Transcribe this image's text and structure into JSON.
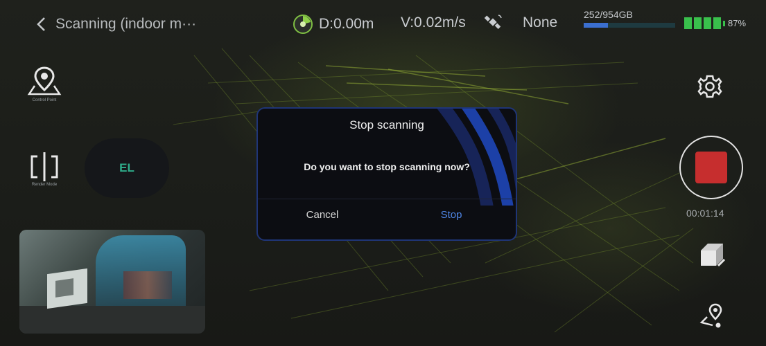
{
  "header": {
    "title": "Scanning (indoor m···",
    "distance": "D:0.00m",
    "velocity": "V:0.02m/s",
    "gnss_status": "None",
    "storage_text": "252/954GB",
    "storage_fraction": 0.264,
    "battery_percent": "87%",
    "battery_segments": 4
  },
  "left_panel": {
    "control_point_label": "Control Point",
    "render_mode_label": "Render Mode",
    "el_button_label": "EL"
  },
  "right_panel": {
    "record_timer": "00:01:14"
  },
  "dialog": {
    "title": "Stop scanning",
    "message": "Do you want to stop scanning now?",
    "cancel_label": "Cancel",
    "confirm_label": "Stop"
  },
  "colors": {
    "record": "#c62e2e",
    "battery": "#39c04c",
    "storage_bar": "#3b6fd0",
    "dialog_accent": "#4f86e6",
    "el_text": "#2fae8b"
  },
  "icons": {
    "back": "chevron-left-icon",
    "distance": "distance-gauge-icon",
    "satellite": "satellite-icon",
    "control_point": "map-pin-icon",
    "render_mode": "split-view-icon",
    "settings": "gear-icon",
    "record": "stop-record-icon",
    "model": "cube-icon",
    "waypoint": "route-pin-icon"
  }
}
